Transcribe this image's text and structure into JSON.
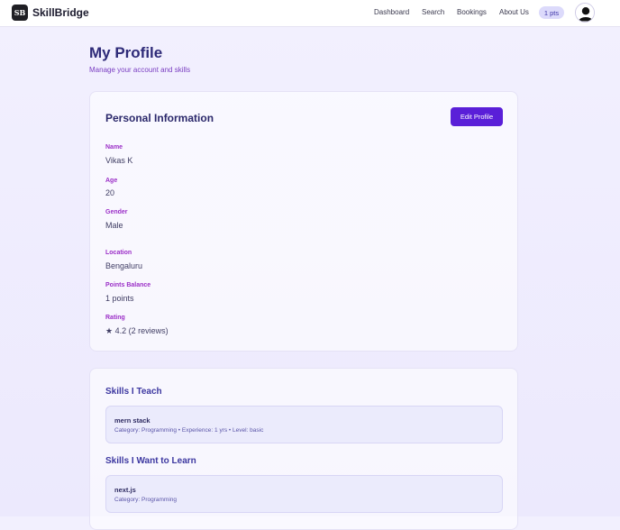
{
  "navbar": {
    "brand_logo": "SB",
    "brand_name": "SkillBridge",
    "links": [
      "Dashboard",
      "Search",
      "Bookings",
      "About Us"
    ],
    "points_badge": "1 pts"
  },
  "header": {
    "title": "My Profile",
    "subtitle": "Manage your account and skills"
  },
  "personal_info": {
    "title": "Personal Information",
    "edit_label": "Edit Profile",
    "fields": [
      {
        "label": "Name",
        "value": "Vikas K"
      },
      {
        "label": "Age",
        "value": "20"
      },
      {
        "label": "Gender",
        "value": "Male"
      },
      {
        "label": "Location",
        "value": "Bengaluru"
      },
      {
        "label": "Points Balance",
        "value": "1 points"
      },
      {
        "label": "Rating",
        "value": "★ 4.2 (2 reviews)"
      }
    ]
  },
  "skills": {
    "teach_title": "Skills I Teach",
    "teach": [
      {
        "name": "mern stack",
        "meta": "Category: Programming • Experience: 1 yrs • Level: basic"
      }
    ],
    "learn_title": "Skills I Want to Learn",
    "learn": [
      {
        "name": "next.js",
        "meta": "Category: Programming"
      }
    ]
  },
  "colors": {
    "accent": "#5a1fd8",
    "label": "#9b2fc7",
    "badge_bg": "#dcdafb"
  },
  "icons": {
    "avatar": "user-avatar-icon"
  }
}
